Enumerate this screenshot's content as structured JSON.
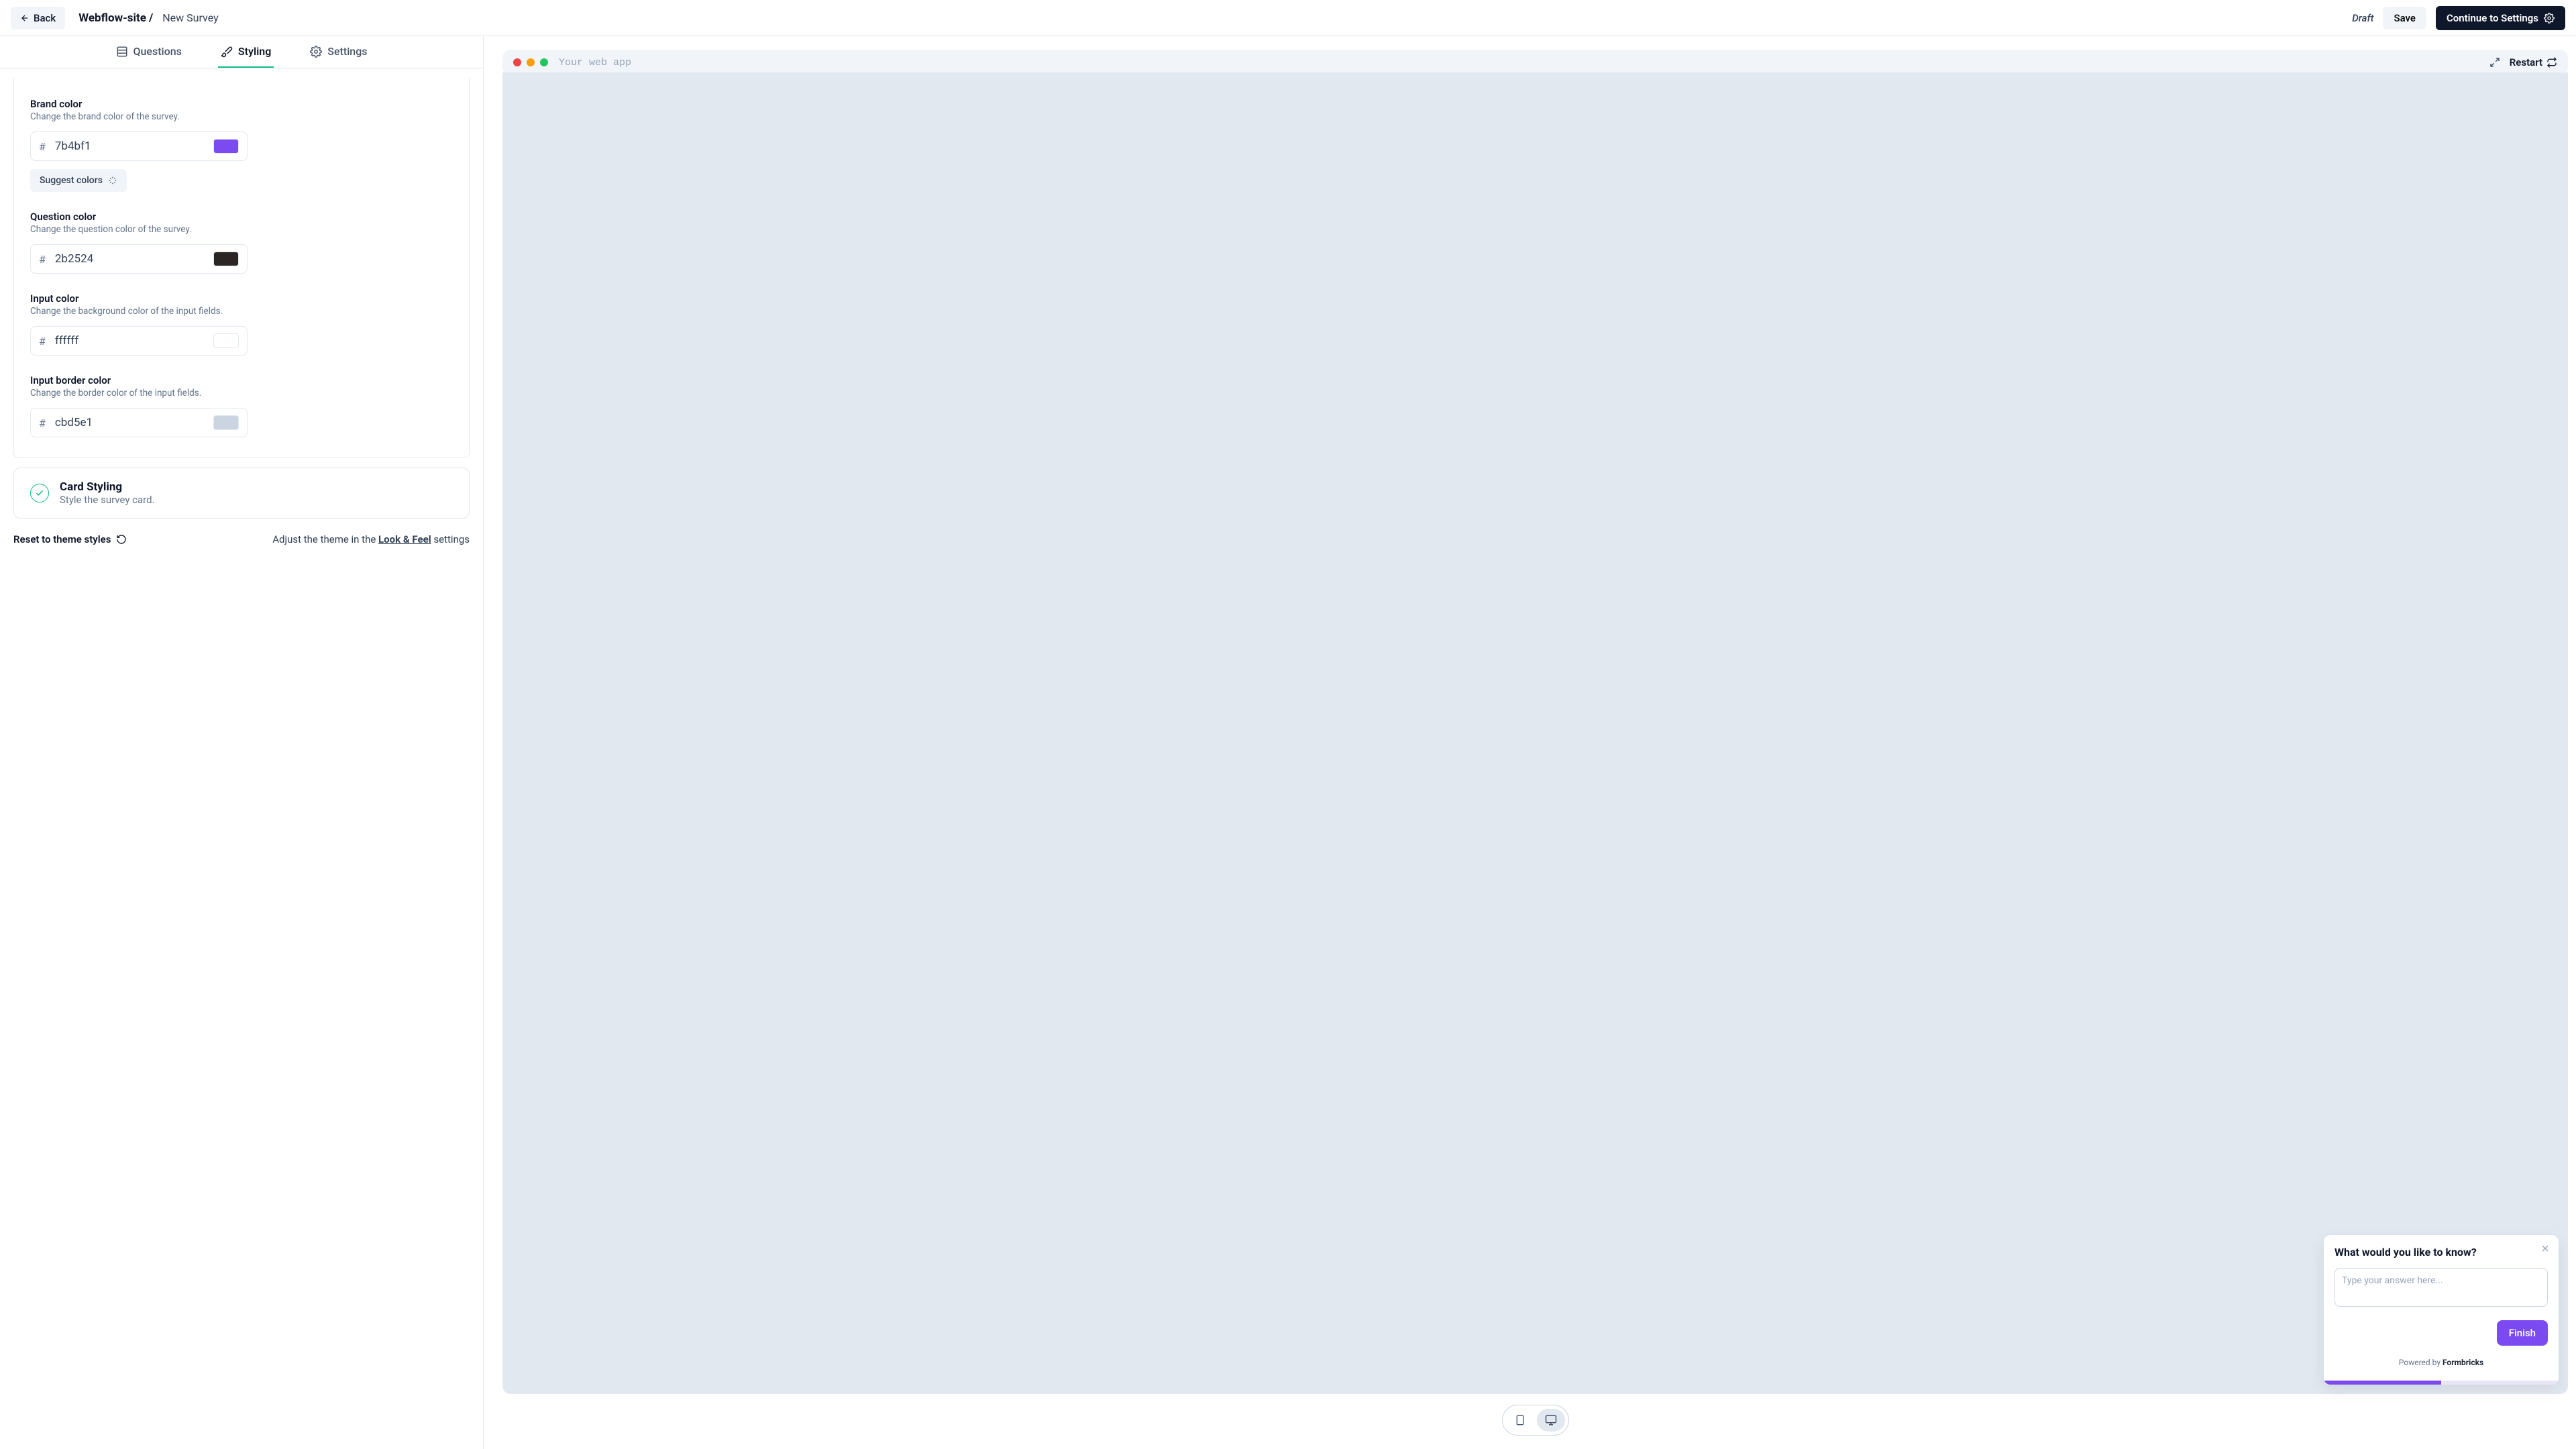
{
  "header": {
    "back_label": "Back",
    "breadcrumb_root": "Webflow-site",
    "breadcrumb_current": "New Survey",
    "draft_label": "Draft",
    "save_label": "Save",
    "continue_label": "Continue to Settings"
  },
  "tabs": {
    "questions": "Questions",
    "styling": "Styling",
    "settings": "Settings"
  },
  "fields": {
    "brand_color": {
      "label": "Brand color",
      "desc": "Change the brand color of the survey.",
      "value": "7b4bf1"
    },
    "suggest_colors_label": "Suggest colors",
    "question_color": {
      "label": "Question color",
      "desc": "Change the question color of the survey.",
      "value": "2b2524"
    },
    "input_color": {
      "label": "Input color",
      "desc": "Change the background color of the input fields.",
      "value": "ffffff"
    },
    "input_border_color": {
      "label": "Input border color",
      "desc": "Change the border color of the input fields.",
      "value": "cbd5e1"
    }
  },
  "card_styling": {
    "title": "Card Styling",
    "desc": "Style the survey card."
  },
  "footer": {
    "reset_label": "Reset to theme styles",
    "adjust_prefix": "Adjust the theme in the ",
    "look_feel": "Look & Feel",
    "adjust_suffix": " settings"
  },
  "preview": {
    "title": "Your web app",
    "restart_label": "Restart",
    "survey_question": "What would you like to know?",
    "survey_placeholder": "Type your answer here...",
    "finish_label": "Finish",
    "powered_prefix": "Powered by ",
    "powered_brand": "Formbricks",
    "progress_percent": 50
  }
}
